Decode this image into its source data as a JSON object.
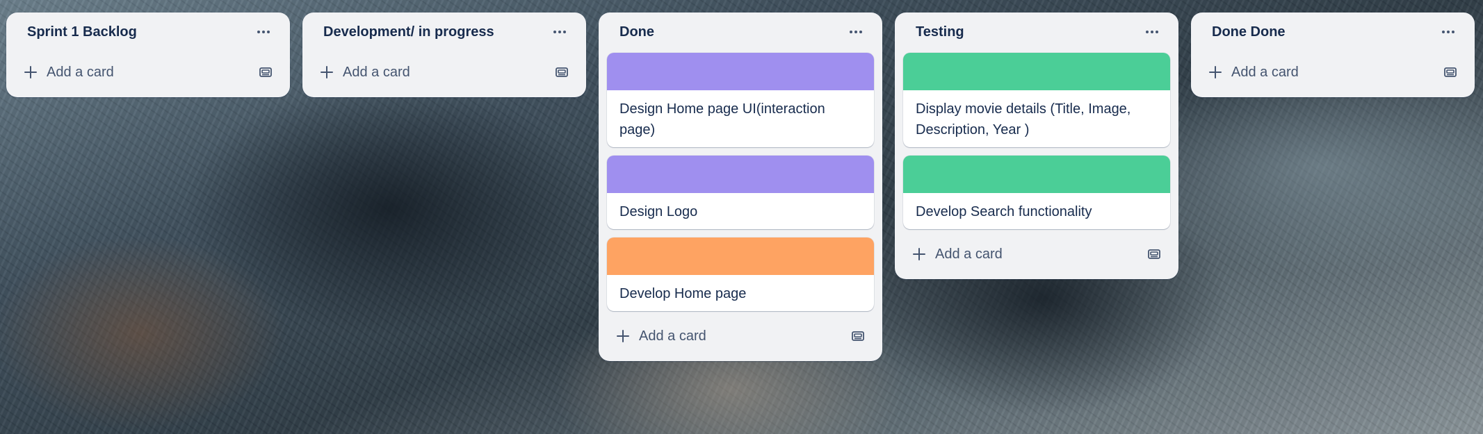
{
  "board": {
    "lists": [
      {
        "title": "Sprint 1 Backlog",
        "cards": [],
        "add_card_label": "Add a card"
      },
      {
        "title": "Development/ in progress",
        "cards": [],
        "add_card_label": "Add a card"
      },
      {
        "title": "Done",
        "cards": [
          {
            "cover_color": "#9f8fef",
            "title": "Design Home page UI(interaction page)"
          },
          {
            "cover_color": "#9f8fef",
            "title": "Design Logo"
          },
          {
            "cover_color": "#fea362",
            "title": "Develop Home page"
          }
        ],
        "add_card_label": "Add a card"
      },
      {
        "title": "Testing",
        "cards": [
          {
            "cover_color": "#4bce97",
            "title": "Display movie details (Title, Image, Description, Year )"
          },
          {
            "cover_color": "#4bce97",
            "title": "Develop Search functionality"
          }
        ],
        "add_card_label": "Add a card"
      },
      {
        "title": "Done Done",
        "cards": [],
        "add_card_label": "Add a card"
      }
    ]
  },
  "icons": {
    "list_menu": "more-horizontal-icon",
    "add": "plus-icon",
    "template": "card-template-icon"
  }
}
